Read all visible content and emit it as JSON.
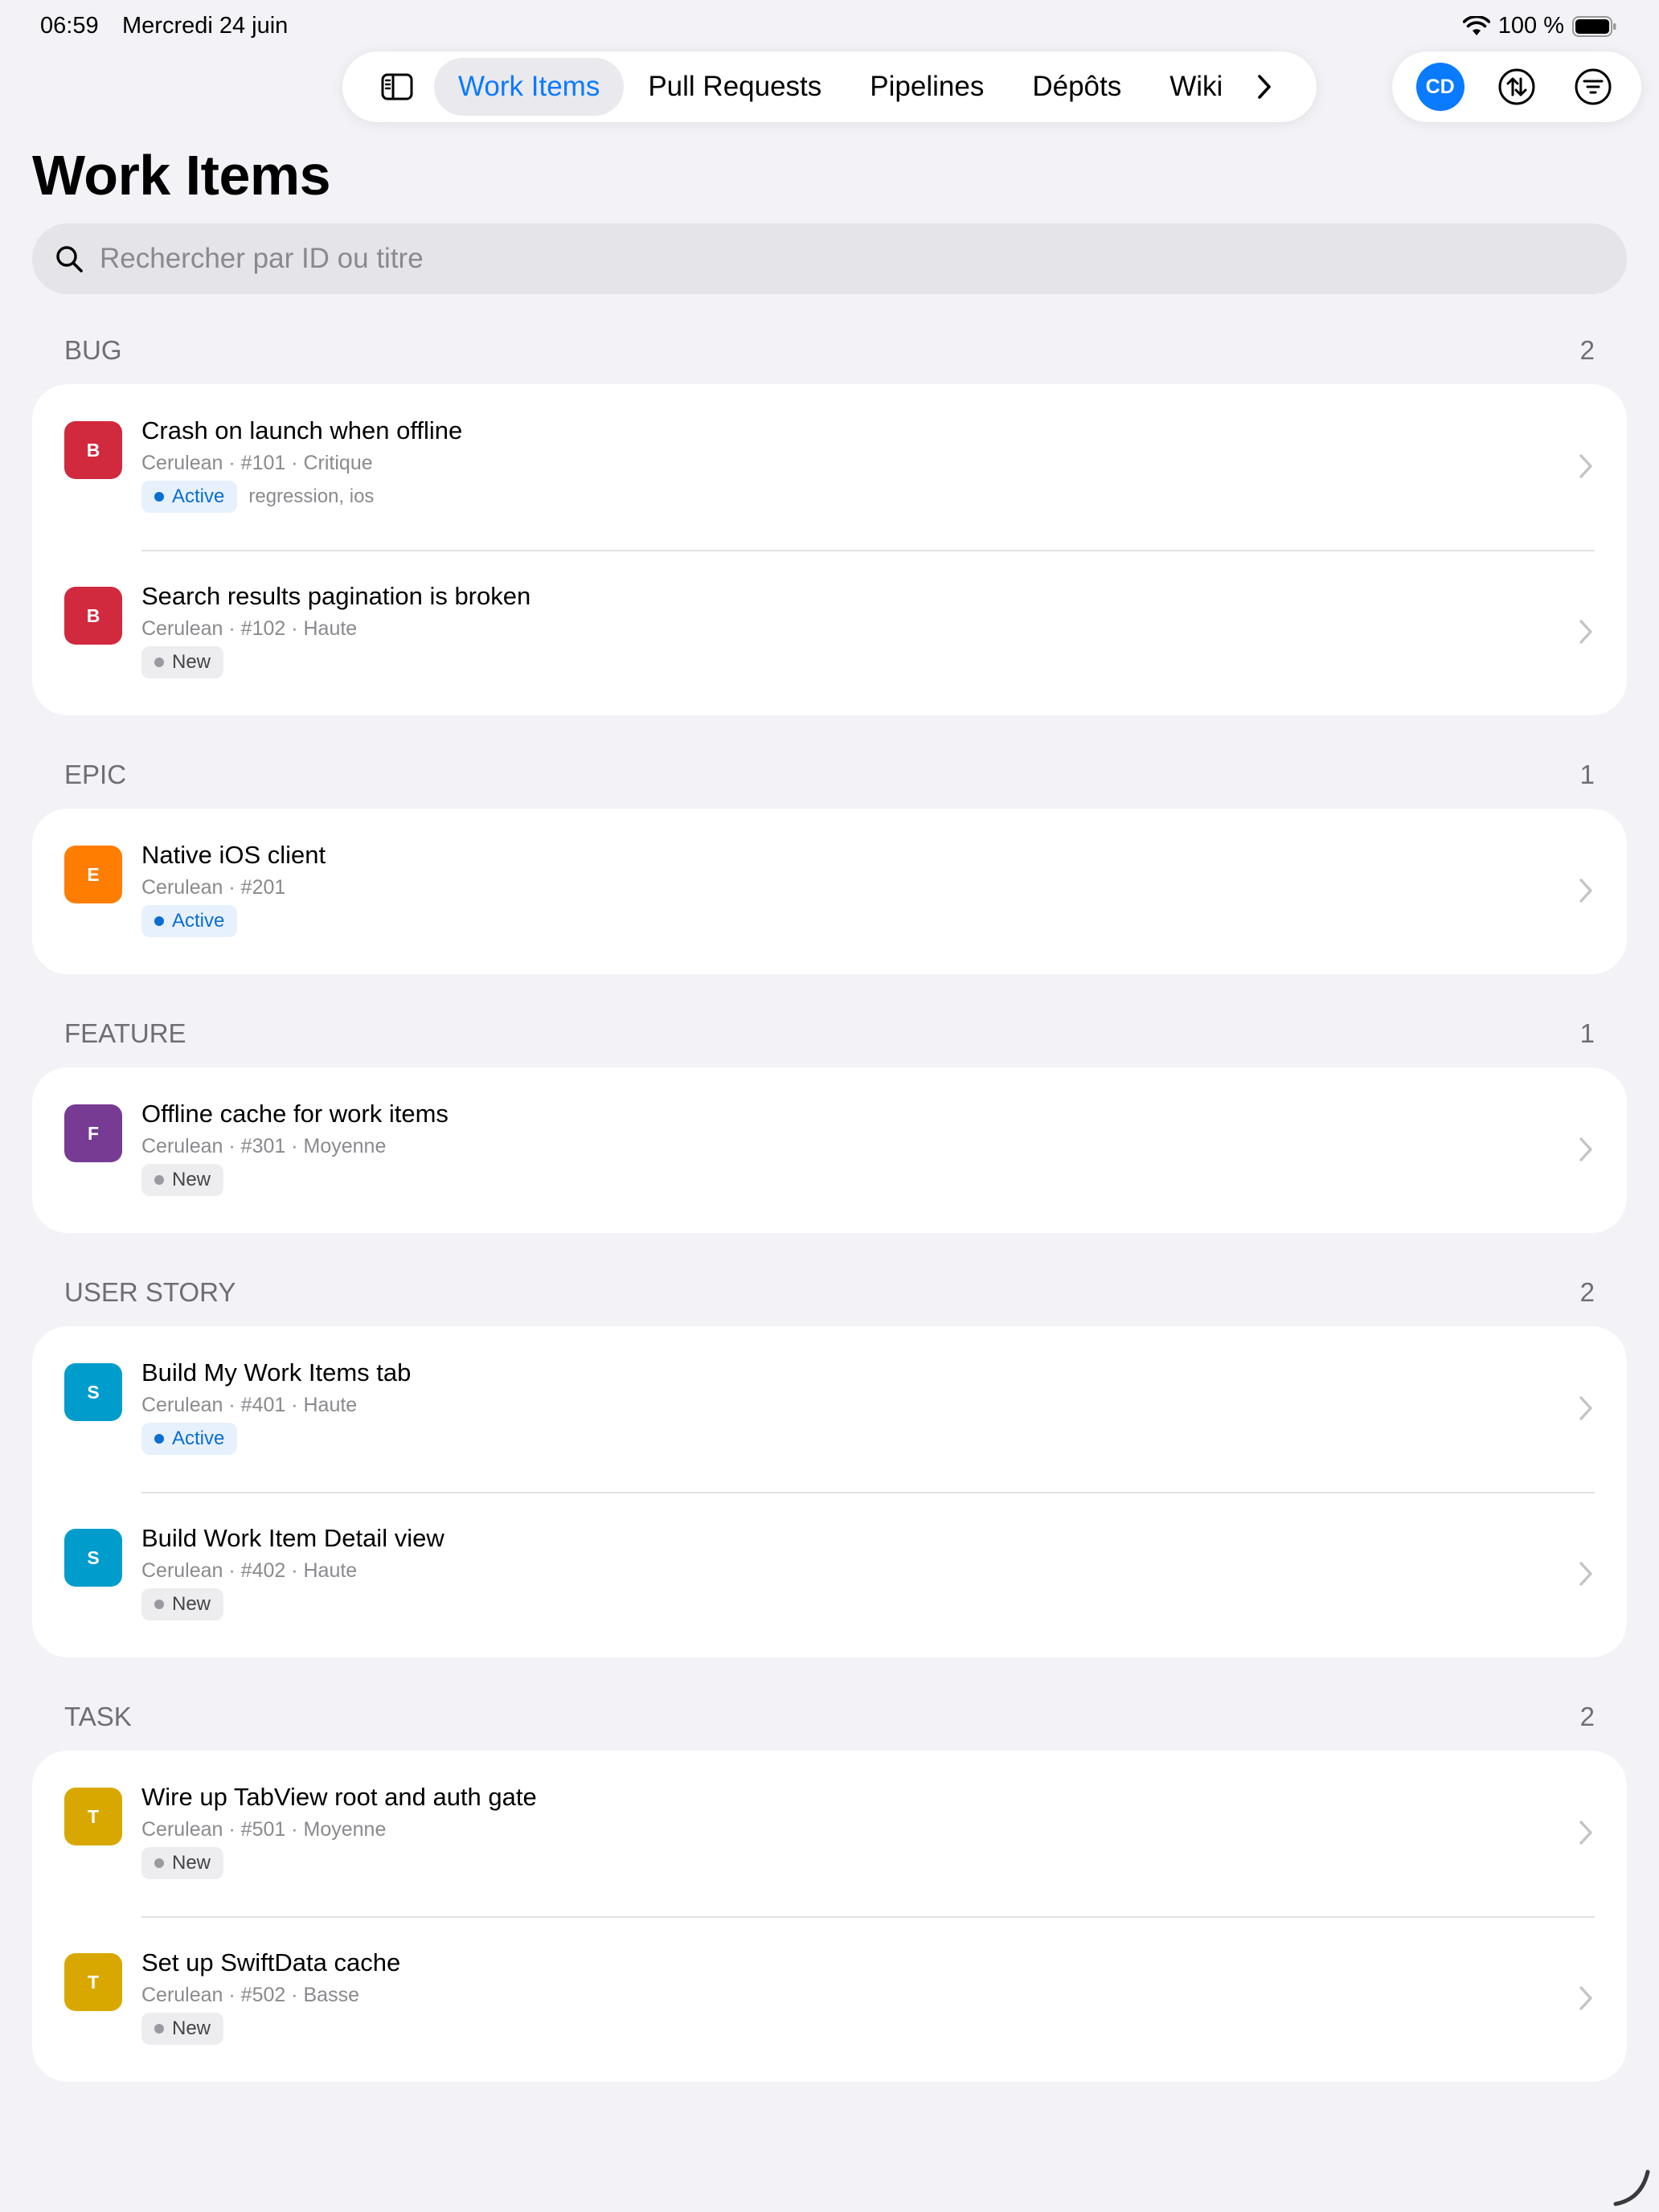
{
  "status": {
    "time": "06:59",
    "date": "Mercredi 24 juin",
    "battery": "100 %"
  },
  "tabs": [
    {
      "label": "Work Items",
      "active": true
    },
    {
      "label": "Pull Requests",
      "active": false
    },
    {
      "label": "Pipelines",
      "active": false
    },
    {
      "label": "Dépôts",
      "active": false
    },
    {
      "label": "Wiki",
      "active": false
    }
  ],
  "user": {
    "initials": "CD"
  },
  "page": {
    "title": "Work Items"
  },
  "search": {
    "placeholder": "Rechercher par ID ou titre"
  },
  "colors": {
    "accent": "#0a7aff",
    "bug": "#d1293d",
    "epic": "#ff7d00",
    "feature": "#773b93",
    "story": "#009ccc",
    "task": "#d9a800"
  },
  "sections": [
    {
      "name": "BUG",
      "count": "2",
      "items": [
        {
          "letter": "B",
          "title": "Crash on launch when offline",
          "meta": "Cerulean · #101 · Critique",
          "state": "Active",
          "tags": "regression, ios"
        },
        {
          "letter": "B",
          "title": "Search results pagination is broken",
          "meta": "Cerulean · #102 · Haute",
          "state": "New",
          "tags": ""
        }
      ]
    },
    {
      "name": "EPIC",
      "count": "1",
      "items": [
        {
          "letter": "E",
          "title": "Native iOS client",
          "meta": "Cerulean · #201",
          "state": "Active",
          "tags": ""
        }
      ]
    },
    {
      "name": "FEATURE",
      "count": "1",
      "items": [
        {
          "letter": "F",
          "title": "Offline cache for work items",
          "meta": "Cerulean · #301 · Moyenne",
          "state": "New",
          "tags": ""
        }
      ]
    },
    {
      "name": "USER STORY",
      "count": "2",
      "items": [
        {
          "letter": "S",
          "title": "Build My Work Items tab",
          "meta": "Cerulean · #401 · Haute",
          "state": "Active",
          "tags": ""
        },
        {
          "letter": "S",
          "title": "Build Work Item Detail view",
          "meta": "Cerulean · #402 · Haute",
          "state": "New",
          "tags": ""
        }
      ]
    },
    {
      "name": "TASK",
      "count": "2",
      "items": [
        {
          "letter": "T",
          "title": "Wire up TabView root and auth gate",
          "meta": "Cerulean · #501 · Moyenne",
          "state": "New",
          "tags": ""
        },
        {
          "letter": "T",
          "title": "Set up SwiftData cache",
          "meta": "Cerulean · #502 · Basse",
          "state": "New",
          "tags": ""
        }
      ]
    }
  ]
}
